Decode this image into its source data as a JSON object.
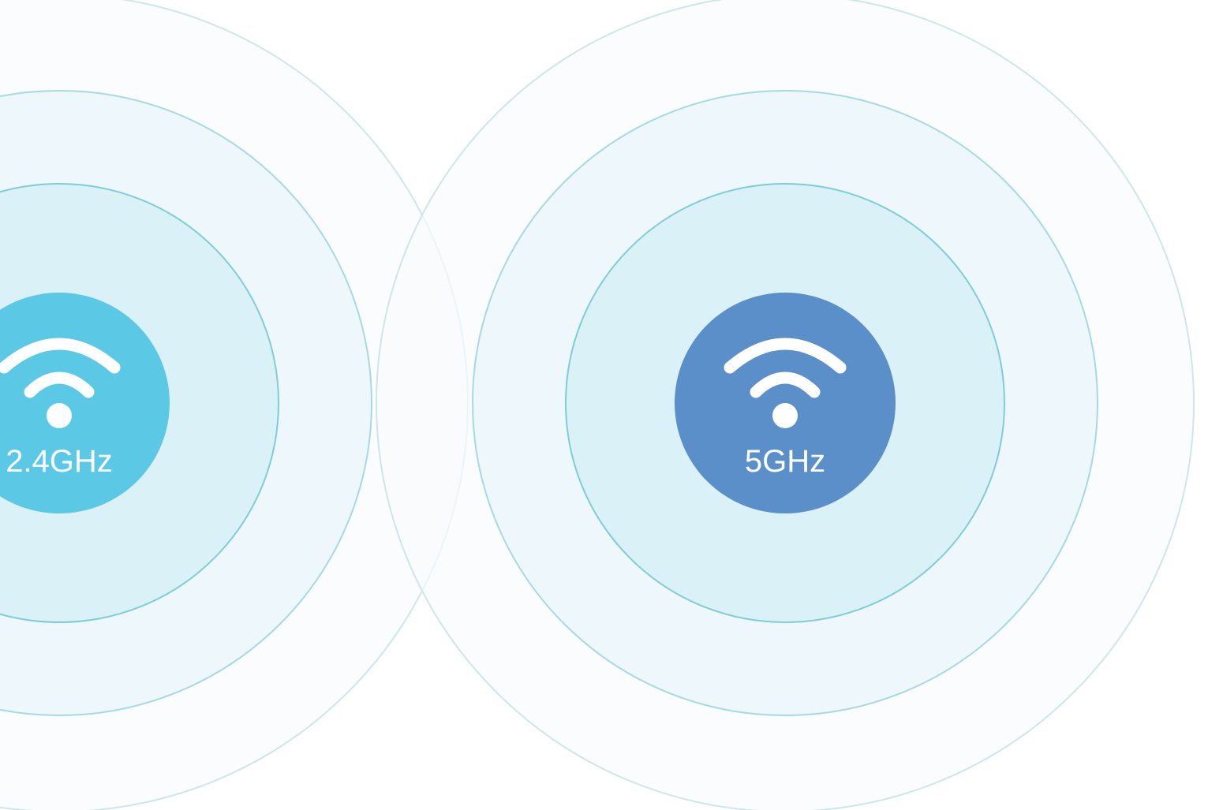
{
  "bands": [
    {
      "label": "2.4GHz",
      "icon": "wifi-icon",
      "color": "#5bc8e5"
    },
    {
      "label": "5GHz",
      "icon": "wifi-icon",
      "color": "#5b8fca"
    }
  ],
  "ring_colors": {
    "outer_fill": "#f8fbfc",
    "outer_stroke": "#cde6ea",
    "middle_fill": "#eef7fc",
    "middle_stroke": "#a6dae2",
    "inner_fill": "#daf1f8",
    "inner_stroke": "#7fcdd6"
  }
}
